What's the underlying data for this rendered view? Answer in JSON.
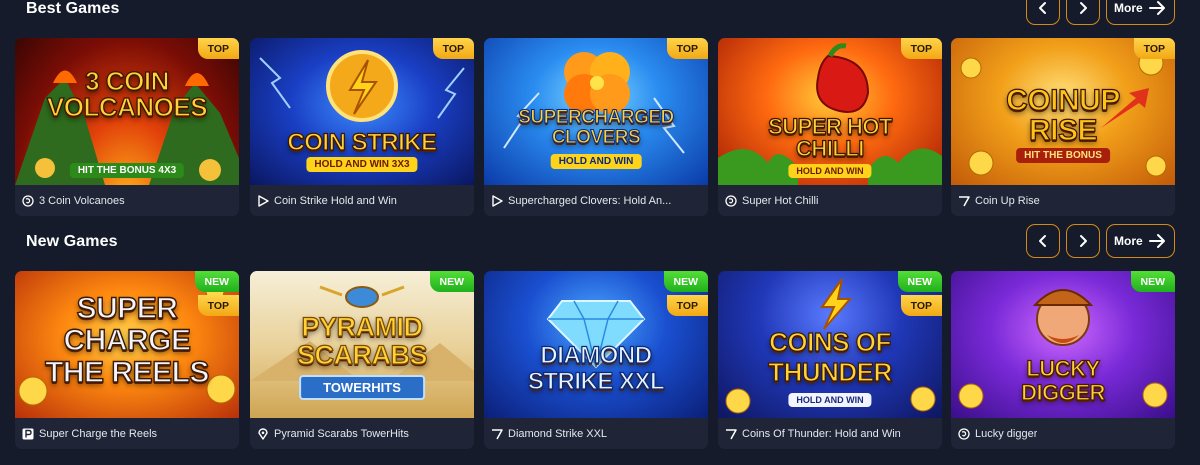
{
  "best": {
    "title": "Best Games",
    "prev_icon": "chevron-left-icon",
    "next_icon": "chevron-right-icon",
    "more_label": "More",
    "more_icon": "arrow-right-icon",
    "games": [
      {
        "name": "3 Coin Volcanoes",
        "badges": [
          "TOP"
        ],
        "provider_icon": "spiral-provider-icon",
        "art_title": "3 COIN VOLCANOES",
        "art_sub": "HIT the BONUS 4x3"
      },
      {
        "name": "Coin Strike Hold and Win",
        "badges": [
          "TOP"
        ],
        "provider_icon": "play-provider-icon",
        "art_title": "COIN STRIKE",
        "art_sub": "HOLD AND WIN 3x3"
      },
      {
        "name": "Supercharged Clovers: Hold An...",
        "badges": [
          "TOP"
        ],
        "provider_icon": "play-provider-icon",
        "art_title": "SUPERCHARGED CLOVERS",
        "art_sub": "HOLD AND WIN"
      },
      {
        "name": "Super Hot Chilli",
        "badges": [
          "TOP"
        ],
        "provider_icon": "spiral-provider-icon",
        "art_title": "SUPER HOT CHILLI",
        "art_sub": "HOLD AND WIN"
      },
      {
        "name": "Coin Up Rise",
        "badges": [
          "TOP"
        ],
        "provider_icon": "seven-provider-icon",
        "art_title": "COINUP RISE",
        "art_sub": "HIT THE BONUS"
      }
    ]
  },
  "new": {
    "title": "New Games",
    "prev_icon": "chevron-left-icon",
    "next_icon": "chevron-right-icon",
    "more_label": "More",
    "more_icon": "arrow-right-icon",
    "games": [
      {
        "name": "Super Charge the Reels",
        "badges": [
          "NEW",
          "TOP"
        ],
        "provider_icon": "p-provider-icon",
        "art_title": "SUPER CHARGE THE REELS",
        "art_sub": ""
      },
      {
        "name": "Pyramid Scarabs TowerHits",
        "badges": [
          "NEW"
        ],
        "provider_icon": "pin-provider-icon",
        "art_title": "PYRAMID SCARABS",
        "art_sub": "TOWERHITS"
      },
      {
        "name": "Diamond Strike XXL",
        "badges": [
          "NEW",
          "TOP"
        ],
        "provider_icon": "seven-provider-icon",
        "art_title": "DIAMOND STRIKE XXL",
        "art_sub": ""
      },
      {
        "name": "Coins Of Thunder: Hold and Win",
        "badges": [
          "NEW",
          "TOP"
        ],
        "provider_icon": "seven-provider-icon",
        "art_title": "COINS OF THUNDER",
        "art_sub": "HOLD AND WIN"
      },
      {
        "name": "Lucky digger",
        "badges": [
          "NEW"
        ],
        "provider_icon": "spiral-provider-icon",
        "art_title": "LUCKY DIGGER",
        "art_sub": ""
      }
    ]
  },
  "colors": {
    "background": "#161b2c",
    "card": "#1f2537",
    "accent_border": "#d48a12",
    "badge_top": "#f2a814",
    "badge_new": "#2ec224"
  }
}
